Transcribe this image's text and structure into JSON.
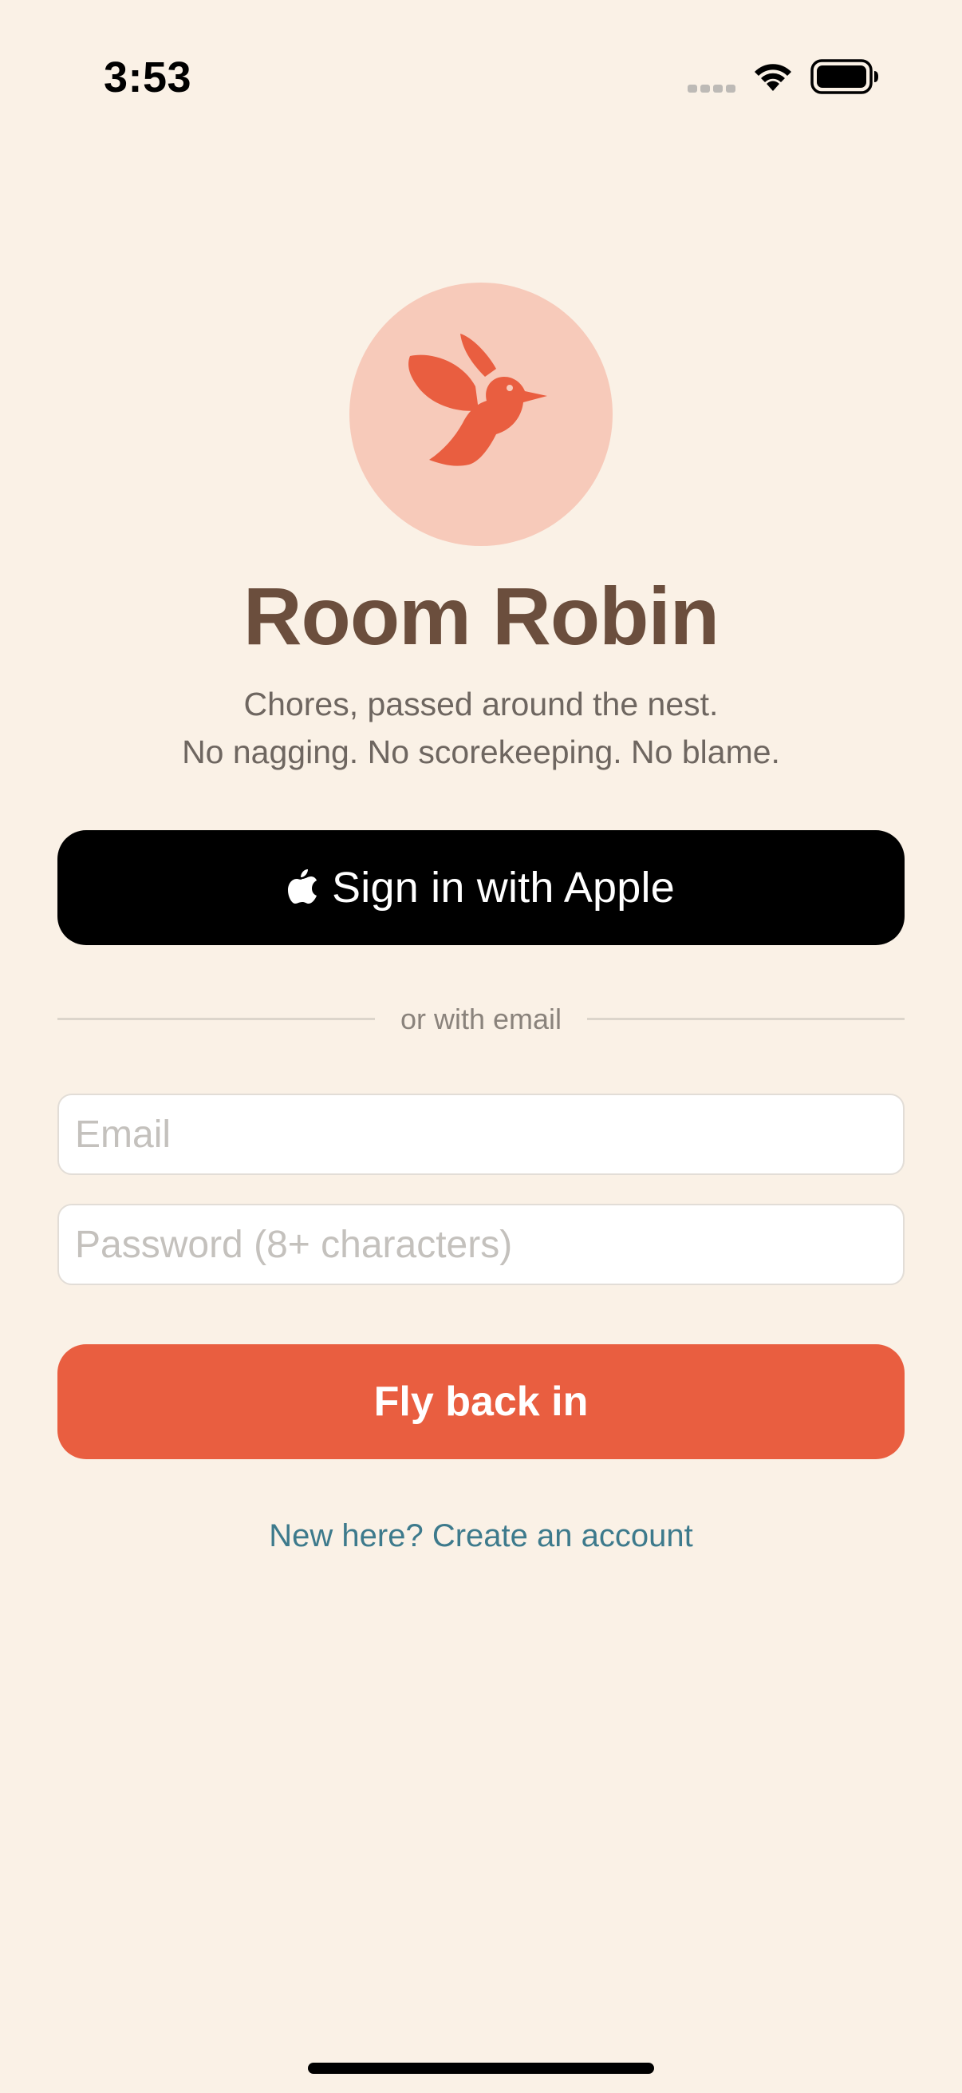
{
  "status_bar": {
    "time": "3:53",
    "icons": [
      "cellular-signal-icon",
      "wifi-icon",
      "battery-icon"
    ]
  },
  "logo": {
    "icon": "bird-icon",
    "colors": {
      "circle": "#F7CABA",
      "bird": "#E95E40"
    }
  },
  "app": {
    "title": "Room Robin",
    "tagline_line1": "Chores, passed around the nest.",
    "tagline_line2": "No nagging. No scorekeeping. No blame."
  },
  "apple_button": {
    "icon": "apple-logo-icon",
    "label": "Sign in with Apple"
  },
  "divider": {
    "text": "or with email"
  },
  "form": {
    "email": {
      "value": "",
      "placeholder": "Email"
    },
    "password": {
      "value": "",
      "placeholder": "Password (8+ characters)"
    },
    "submit_label": "Fly back in"
  },
  "footer": {
    "create_account_label": "New here? Create an account"
  },
  "colors": {
    "background": "#FAF1E6",
    "accent": "#E95E40",
    "title": "#6B4E3D",
    "link": "#3D7A8C"
  }
}
